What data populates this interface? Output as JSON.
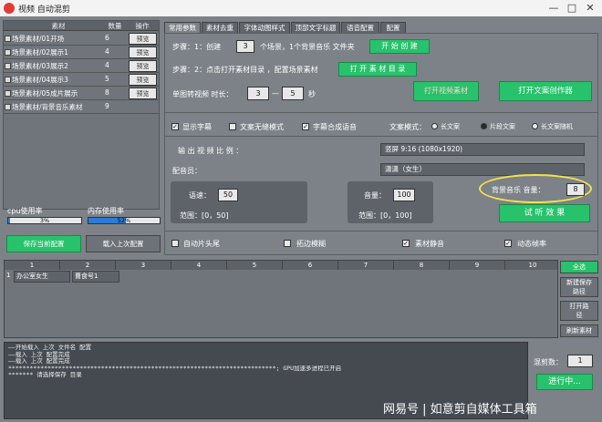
{
  "window": {
    "title": "视频 自动混剪",
    "minimize": "—",
    "maximize": "□",
    "close": "✕"
  },
  "material_table": {
    "headers": [
      "素材",
      "数量",
      "操作"
    ],
    "rows": [
      {
        "name": "场景素材/01开场",
        "count": "6",
        "action": "预览"
      },
      {
        "name": "场景素材/02展示1",
        "count": "4",
        "action": "预览"
      },
      {
        "name": "场景素材/03展示2",
        "count": "4",
        "action": "预览"
      },
      {
        "name": "场景素材/04展示3",
        "count": "5",
        "action": "预览"
      },
      {
        "name": "场景素材/05成片展示",
        "count": "8",
        "action": "预览"
      },
      {
        "name": "场景素材/背景音乐素材",
        "count": "9",
        "action": ""
      }
    ]
  },
  "usage": {
    "cpu_label": "cpu使用率",
    "cpu_value": "3%",
    "cpu_fraction": 0.03,
    "mem_label": "内存使用率",
    "mem_value": "52%",
    "mem_fraction": 0.52
  },
  "left_buttons": {
    "save": "保存当前配置",
    "load": "载入上次配置"
  },
  "tabs": [
    "常用参数",
    "素材去重",
    "字体动图样式",
    "顶部文字标题",
    "语音配置",
    "配置"
  ],
  "step1": {
    "label": "步骤：1：创建",
    "count": "3",
    "desc": "个场景，1个背景音乐 文件夹",
    "button": "开 始 创 建"
  },
  "step2": {
    "label": "步骤：2：点击打开素材目录 ，配置场景素材",
    "button": "打 开 素 材 目 录"
  },
  "rotate": {
    "label": "单图转视频 时长：",
    "min": "3",
    "dash": "—",
    "max": "5",
    "unit": "秒"
  },
  "buttons": {
    "open_folder": "打开视频素材",
    "open_creator": "打开文案创作器"
  },
  "options": {
    "show_subtitle": "显示字幕",
    "seamless": "文案无缝模式",
    "subtitle_voice": "字幕合成语音",
    "mode_label": "文案模式：",
    "mode_long": "长文案",
    "mode_segment": "片段文案",
    "mode_random": "长文案随机"
  },
  "video_ratio": {
    "label": "输 出 视 频 比 例 ：",
    "value": "竖屏 9:16 (1080x1920)"
  },
  "voice_actor": {
    "label": "配音员：",
    "value": "潇潇（女生）"
  },
  "speed": {
    "label": "语速：",
    "value": "50",
    "range": "范围：[0，50]"
  },
  "volume": {
    "label": "音量：",
    "value": "100",
    "range": "范围：[0，100]"
  },
  "bgm": {
    "label": "背景音乐 音量：",
    "value": "8"
  },
  "preview_button": "试 听 效 果",
  "bottom_options": {
    "auto_head": "自动片头尾",
    "blur": "拓边模糊",
    "mute": "素材静音",
    "dynamic": "动态帧率"
  },
  "grid": {
    "columns": [
      "1",
      "2",
      "3",
      "4",
      "5",
      "6",
      "7",
      "8",
      "9",
      "10"
    ],
    "row_number": "1",
    "cells": [
      "办公室女生",
      "曹食号1"
    ]
  },
  "right_buttons": {
    "select_all": "全选",
    "new_path": "新建保存路径",
    "open_path": "打开路径",
    "refresh": "刷新素材"
  },
  "log_lines": [
    "——开始载入 上次 文件名  配置",
    "——载入 上次 配置完成",
    "——载入 上次 配置完成",
    "***************************************************************************; GPU加速多进程已开启",
    "******* 请选择保存 目录"
  ],
  "mix_count": {
    "label": "混剪数：",
    "value": "1"
  },
  "run_button": "进行中...",
  "watermark": "网易号 | 如意剪自媒体工具箱"
}
